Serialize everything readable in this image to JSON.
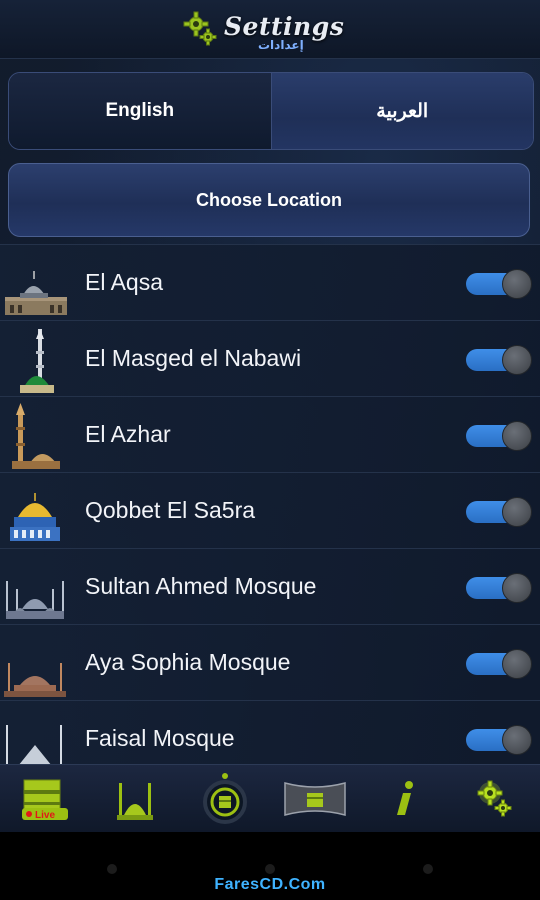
{
  "header": {
    "title": "Settings",
    "subtitle": "إعدادات"
  },
  "language": {
    "english": "English",
    "arabic": "العربية"
  },
  "choose_location": "Choose Location",
  "mosques": [
    {
      "label": "El Aqsa",
      "icon": "aqsa-dome-icon",
      "enabled": true
    },
    {
      "label": "El Masged el Nabawi",
      "icon": "nabawi-mosque-icon",
      "enabled": true
    },
    {
      "label": "El Azhar",
      "icon": "azhar-mosque-icon",
      "enabled": true
    },
    {
      "label": "Qobbet El Sa5ra",
      "icon": "dome-of-rock-icon",
      "enabled": true
    },
    {
      "label": "Sultan Ahmed Mosque",
      "icon": "sultan-ahmed-mosque-icon",
      "enabled": true
    },
    {
      "label": "Aya Sophia Mosque",
      "icon": "aya-sophia-icon",
      "enabled": true
    },
    {
      "label": "Faisal Mosque",
      "icon": "faisal-mosque-icon",
      "enabled": true
    }
  ],
  "tabs": [
    {
      "icon": "kaaba-live-icon",
      "badge": "Live"
    },
    {
      "icon": "mosque-icon"
    },
    {
      "icon": "qibla-compass-icon"
    },
    {
      "icon": "kaaba-panorama-icon"
    },
    {
      "icon": "info-icon"
    },
    {
      "icon": "settings-gear-icon"
    }
  ],
  "watermark": "FaresCD.Com",
  "colors": {
    "toggle_on": "#3f8ee8",
    "button_blue": "#253868",
    "active_tab_gear": "#b8e020"
  }
}
